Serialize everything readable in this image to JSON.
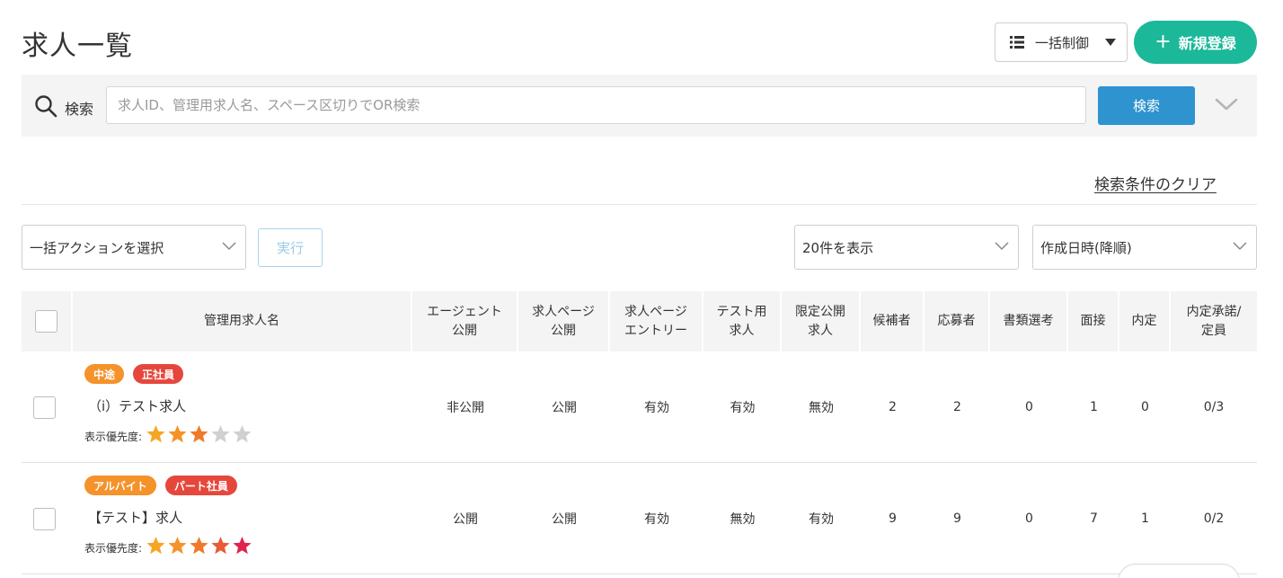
{
  "page": {
    "title": "求人一覧"
  },
  "toolbar": {
    "bulk_control_label": "一括制御",
    "new_register_label": "新規登録"
  },
  "search": {
    "label": "検索",
    "placeholder": "求人ID、管理用求人名、スペース区切りでOR検索",
    "value": "",
    "button_label": "検索",
    "clear_link": "検索条件のクリア"
  },
  "actions": {
    "bulk_action_selected": "一括アクションを選択",
    "execute_label": "実行",
    "per_page_selected": "20件を表示",
    "sort_selected": "作成日時(降順)"
  },
  "table": {
    "columns": [
      {
        "key": "name",
        "label": "管理用求人名"
      },
      {
        "key": "agent",
        "label": "エージェント\n公開"
      },
      {
        "key": "page",
        "label": "求人ページ\n公開"
      },
      {
        "key": "entry",
        "label": "求人ページ\nエントリー"
      },
      {
        "key": "test",
        "label": "テスト用\n求人"
      },
      {
        "key": "limited",
        "label": "限定公開\n求人"
      },
      {
        "key": "candidates",
        "label": "候補者"
      },
      {
        "key": "applicants",
        "label": "応募者"
      },
      {
        "key": "screening",
        "label": "書類選考"
      },
      {
        "key": "interview",
        "label": "面接"
      },
      {
        "key": "offer",
        "label": "内定"
      },
      {
        "key": "accepted",
        "label": "内定承諾/\n定員"
      }
    ],
    "priority_label": "表示優先度:",
    "rows": [
      {
        "badges": [
          {
            "label": "中途",
            "color": "#f5922a"
          },
          {
            "label": "正社員",
            "color": "#e6473c"
          }
        ],
        "name": "（i）テスト求人",
        "priority": 3,
        "agent": "非公開",
        "page": "公開",
        "entry": "有効",
        "test": "有効",
        "limited": "無効",
        "candidates": "2",
        "applicants": "2",
        "screening": "0",
        "interview": "1",
        "offer": "0",
        "accepted": "0/3"
      },
      {
        "badges": [
          {
            "label": "アルバイト",
            "color": "#f5922a"
          },
          {
            "label": "パート社員",
            "color": "#e6473c"
          }
        ],
        "name": "【テスト】求人",
        "priority": 5,
        "agent": "公開",
        "page": "公開",
        "entry": "有効",
        "test": "無効",
        "limited": "有効",
        "candidates": "9",
        "applicants": "9",
        "screening": "0",
        "interview": "7",
        "offer": "1",
        "accepted": "0/2"
      }
    ]
  },
  "colors": {
    "accent_green": "#1bb899",
    "search_blue": "#2e93cf",
    "star_colors": [
      "#f5a623",
      "#f5922a",
      "#f07a2a",
      "#ea5a35",
      "#e0234e"
    ],
    "star_empty": "#d0d0d0"
  },
  "icons": {
    "bulk": "list-icon",
    "search": "search-icon",
    "expand": "chevron-down-icon",
    "star": "star-icon"
  }
}
